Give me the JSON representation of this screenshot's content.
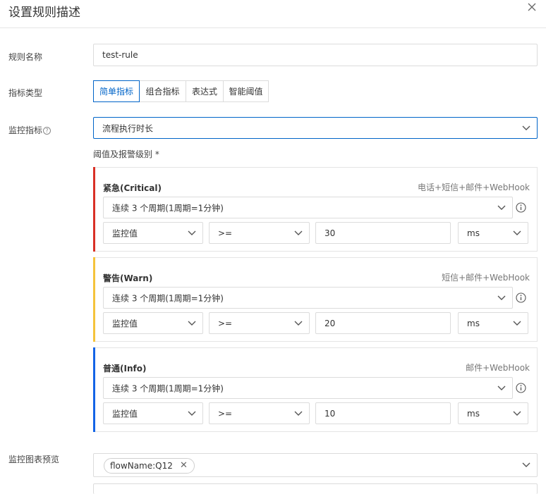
{
  "dialog": {
    "title": "设置规则描述",
    "close_icon": "close-icon"
  },
  "form": {
    "rule_name": {
      "label": "规则名称",
      "value": "test-rule"
    },
    "metric_type": {
      "label": "指标类型",
      "options": [
        "简单指标",
        "组合指标",
        "表达式",
        "智能阈值"
      ],
      "selected": "简单指标"
    },
    "metric": {
      "label": "监控指标",
      "help_icon": "question-icon",
      "value": "流程执行时长"
    },
    "threshold_label": "阈值及报警级别 *",
    "levels": [
      {
        "name": "紧急(Critical)",
        "channels": "电话+短信+邮件+WebHook",
        "color": "#d93026",
        "period": "连续 3 个周期(1周期=1分钟)",
        "stat": "监控值",
        "operator": ">=",
        "value": "30",
        "unit": "ms"
      },
      {
        "name": "警告(Warn)",
        "channels": "短信+邮件+WebHook",
        "color": "#f5c33b",
        "period": "连续 3 个周期(1周期=1分钟)",
        "stat": "监控值",
        "operator": ">=",
        "value": "20",
        "unit": "ms"
      },
      {
        "name": "普通(Info)",
        "channels": "邮件+WebHook",
        "color": "#1464e6",
        "period": "连续 3 个周期(1周期=1分钟)",
        "stat": "监控值",
        "operator": ">=",
        "value": "10",
        "unit": "ms"
      }
    ],
    "chart_preview": {
      "label": "监控图表预览",
      "tag": "flowName:Q12"
    }
  },
  "colors": {
    "accent": "#0064c8",
    "border": "#dcdcdc"
  }
}
